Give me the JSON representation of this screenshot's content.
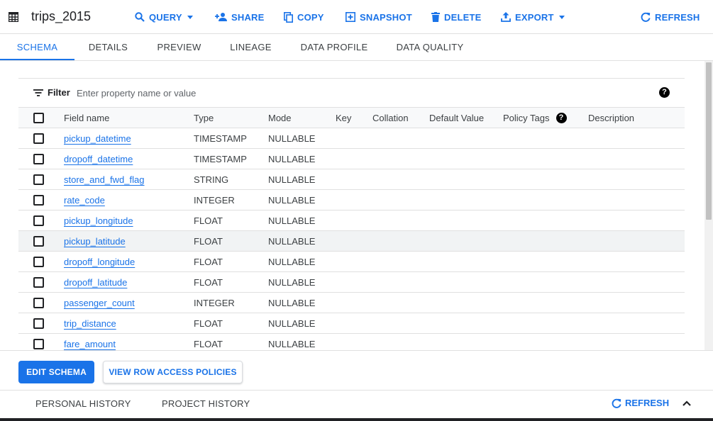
{
  "header": {
    "title": "trips_2015",
    "actions": {
      "query": "QUERY",
      "share": "SHARE",
      "copy": "COPY",
      "snapshot": "SNAPSHOT",
      "delete": "DELETE",
      "export": "EXPORT",
      "refresh": "REFRESH"
    }
  },
  "tabs": [
    "SCHEMA",
    "DETAILS",
    "PREVIEW",
    "LINEAGE",
    "DATA PROFILE",
    "DATA QUALITY"
  ],
  "active_tab": "SCHEMA",
  "filter": {
    "label": "Filter",
    "placeholder": "Enter property name or value"
  },
  "schema": {
    "columns": [
      "Field name",
      "Type",
      "Mode",
      "Key",
      "Collation",
      "Default Value",
      "Policy Tags",
      "Description"
    ],
    "rows": [
      {
        "name": "pickup_datetime",
        "type": "TIMESTAMP",
        "mode": "NULLABLE"
      },
      {
        "name": "dropoff_datetime",
        "type": "TIMESTAMP",
        "mode": "NULLABLE"
      },
      {
        "name": "store_and_fwd_flag",
        "type": "STRING",
        "mode": "NULLABLE"
      },
      {
        "name": "rate_code",
        "type": "INTEGER",
        "mode": "NULLABLE"
      },
      {
        "name": "pickup_longitude",
        "type": "FLOAT",
        "mode": "NULLABLE"
      },
      {
        "name": "pickup_latitude",
        "type": "FLOAT",
        "mode": "NULLABLE"
      },
      {
        "name": "dropoff_longitude",
        "type": "FLOAT",
        "mode": "NULLABLE"
      },
      {
        "name": "dropoff_latitude",
        "type": "FLOAT",
        "mode": "NULLABLE"
      },
      {
        "name": "passenger_count",
        "type": "INTEGER",
        "mode": "NULLABLE"
      },
      {
        "name": "trip_distance",
        "type": "FLOAT",
        "mode": "NULLABLE"
      },
      {
        "name": "fare_amount",
        "type": "FLOAT",
        "mode": "NULLABLE"
      }
    ],
    "highlighted_row": "pickup_latitude"
  },
  "buttons": {
    "edit_schema": "EDIT SCHEMA",
    "row_access": "VIEW ROW ACCESS POLICIES"
  },
  "history": {
    "personal": "PERSONAL HISTORY",
    "project": "PROJECT HISTORY",
    "refresh": "REFRESH"
  },
  "colors": {
    "accent": "#1a73e8",
    "text": "#202124",
    "muted": "#3c4043",
    "divider": "#e0e0e0"
  },
  "icons": [
    "table-icon",
    "search-icon",
    "person-add-icon",
    "copy-icon",
    "snapshot-icon",
    "delete-icon",
    "export-icon",
    "refresh-icon",
    "filter-icon",
    "help-icon",
    "chevron-up-icon"
  ]
}
